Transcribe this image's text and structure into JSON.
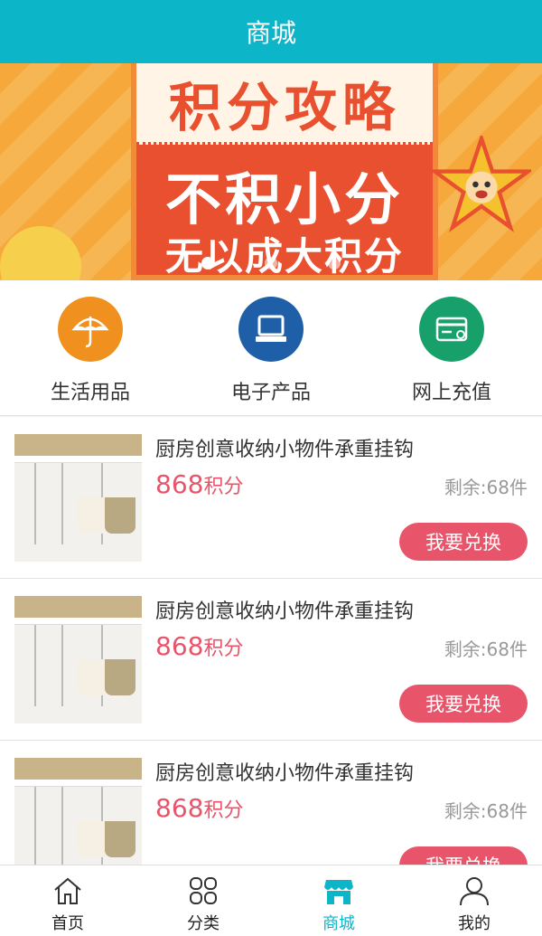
{
  "header": {
    "title": "商城"
  },
  "banner": {
    "title": "积分攻略",
    "line1": "不积小分",
    "line2": "无以成大积分",
    "slide_count": 3,
    "active_slide": 1
  },
  "categories": [
    {
      "label": "生活用品",
      "icon": "umbrella-icon",
      "color": "#f0901f"
    },
    {
      "label": "电子产品",
      "icon": "computer-icon",
      "color": "#1f5fa8"
    },
    {
      "label": "网上充值",
      "icon": "card-icon",
      "color": "#17a06a"
    }
  ],
  "products": [
    {
      "title": "厨房创意收纳小物件承重挂钩",
      "price": "868",
      "unit": "积分",
      "stock": "剩余:68件",
      "button": "我要兑换"
    },
    {
      "title": "厨房创意收纳小物件承重挂钩",
      "price": "868",
      "unit": "积分",
      "stock": "剩余:68件",
      "button": "我要兑换"
    },
    {
      "title": "厨房创意收纳小物件承重挂钩",
      "price": "868",
      "unit": "积分",
      "stock": "剩余:68件",
      "button": "我要兑换"
    }
  ],
  "tabbar": [
    {
      "label": "首页",
      "icon": "home-icon"
    },
    {
      "label": "分类",
      "icon": "category-icon"
    },
    {
      "label": "商城",
      "icon": "shop-icon",
      "active": true
    },
    {
      "label": "我的",
      "icon": "user-icon"
    }
  ],
  "colors": {
    "accent": "#0db5c9",
    "price": "#e8556a"
  }
}
